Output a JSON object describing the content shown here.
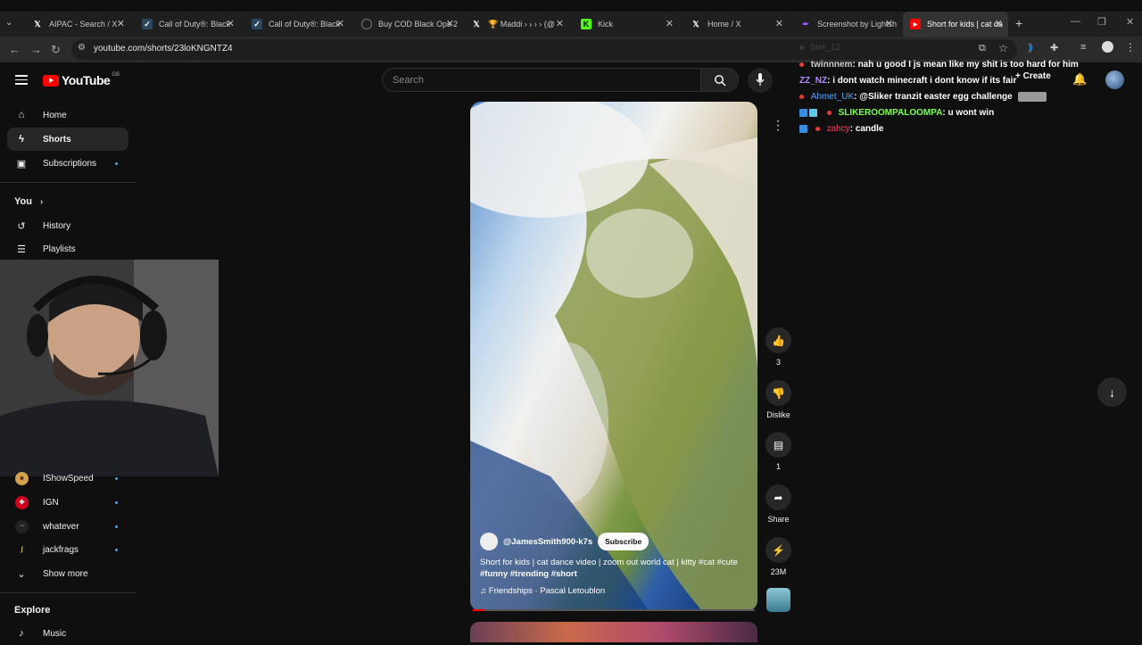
{
  "browser": {
    "tabs": [
      {
        "title": "AIPAC - Search / X",
        "icon": "x-logo-icon",
        "color": "#ffffff"
      },
      {
        "title": "Call of Duty®: Black",
        "icon": "steam-icon",
        "color": "#2a475e"
      },
      {
        "title": "Call of Duty®: Black",
        "icon": "steam-icon",
        "color": "#2a475e"
      },
      {
        "title": "Buy COD Black Ops 2",
        "icon": "site-icon",
        "color": "#666666"
      },
      {
        "title": "🏆 Maddi › › › › (@",
        "icon": "x-logo-icon",
        "color": "#ffffff"
      },
      {
        "title": "Kick",
        "icon": "kick-icon",
        "color": "#53fc18"
      },
      {
        "title": "Home / X",
        "icon": "x-logo-icon",
        "color": "#ffffff"
      },
      {
        "title": "Screenshot by Lightsh",
        "icon": "feather-icon",
        "color": "#9b59ff"
      },
      {
        "title": "Short for kids | cat da",
        "icon": "youtube-icon",
        "color": "#ff0000"
      }
    ],
    "url": "youtube.com/shorts/23loKNGNTZ4"
  },
  "header": {
    "logo_text": "YouTube",
    "region": "GB",
    "search_placeholder": "Search",
    "create_label": "Create"
  },
  "sidebar": {
    "items": [
      {
        "label": "Home",
        "icon": "home-icon"
      },
      {
        "label": "Shorts",
        "icon": "shorts-icon"
      },
      {
        "label": "Subscriptions",
        "icon": "subscriptions-icon"
      }
    ],
    "you_label": "You",
    "you_items": [
      {
        "label": "History",
        "icon": "history-icon"
      },
      {
        "label": "Playlists",
        "icon": "playlists-icon"
      }
    ],
    "channels": [
      {
        "label": "IShowSpeed"
      },
      {
        "label": "IGN"
      },
      {
        "label": "whatever"
      },
      {
        "label": "jackfrags"
      }
    ],
    "show_more": "Show more",
    "explore_label": "Explore",
    "music_label": "Music"
  },
  "short": {
    "channel": "@JamesSmith900-k7s",
    "subscribe_label": "Subscribe",
    "description_line1": "Short for kids | cat dance video | zoom out world cat | kitty #cat #cute",
    "description_line2": "#funny #trending #short",
    "music": "Friendships · Pascal Letoublon",
    "progress": 0.04
  },
  "actions": {
    "likes": "3",
    "dislike_label": "Dislike",
    "comments": "1",
    "share_label": "Share",
    "remix": "23M"
  },
  "chat": [
    {
      "user": "bier_12",
      "message": "",
      "user_color": "#666666"
    },
    {
      "user": "twinnnem",
      "message": "nah u good I js mean like my shit is too hard for him",
      "user_color": "#d0d0d0"
    },
    {
      "user": "ZZ_NZ",
      "message": "i dont watch minecraft i dont know if its fair",
      "user_color": "#b388ff"
    },
    {
      "user": "Ahmet_UK",
      "message": "@Sliker tranzit easter egg challenge",
      "user_color": "#4fa3ff"
    },
    {
      "user": "SLIKEROOMPALOOMPA",
      "message": "u wont win",
      "user_color": "#7cff4f"
    },
    {
      "user": "zahcy",
      "message": "candle",
      "user_color": "#ff3b5c"
    }
  ]
}
